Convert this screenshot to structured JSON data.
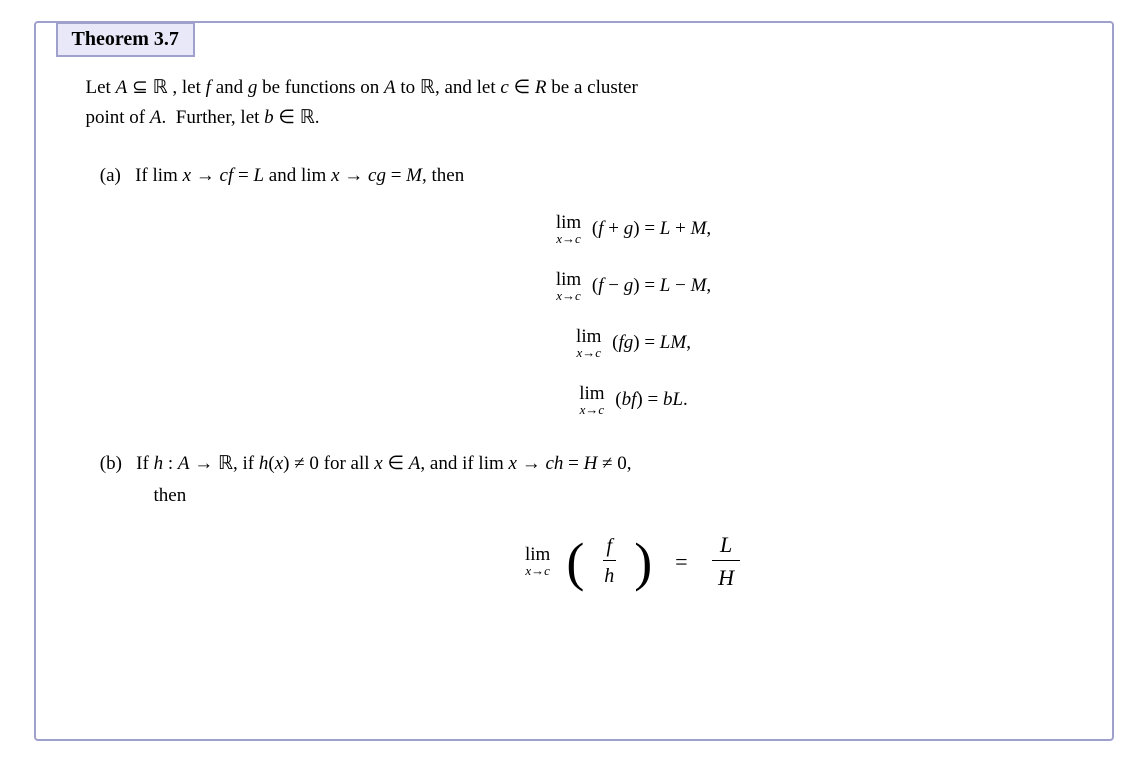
{
  "theorem": {
    "title": "Theorem 3.7",
    "intro": {
      "line1": "Let A ⊆ ℝ , let f and g be functions on A to ℝ, and let c ∈ R be a cluster",
      "line2": "point of A.  Further, let b ∈ ℝ."
    },
    "part_a": {
      "label": "(a)",
      "condition": "If lim x → cf = L and lim x → cg = M, then",
      "equations": [
        {
          "lhs": "lim (f + g)",
          "rhs": "L + M,"
        },
        {
          "lhs": "lim (f − g)",
          "rhs": "L − M,"
        },
        {
          "lhs": "lim (fg)",
          "rhs": "LM,"
        },
        {
          "lhs": "lim (bf)",
          "rhs": "bL."
        }
      ]
    },
    "part_b": {
      "label": "(b)",
      "condition": "If h : A → ℝ, if h(x) ≠ 0 for all x ∈ A, and if lim x → ch = H ≠ 0,",
      "then": "then",
      "eq_lhs_num": "f",
      "eq_lhs_den": "h",
      "eq_rhs_num": "L",
      "eq_rhs_den": "H",
      "lim_label": "lim",
      "lim_under": "x→c"
    }
  }
}
